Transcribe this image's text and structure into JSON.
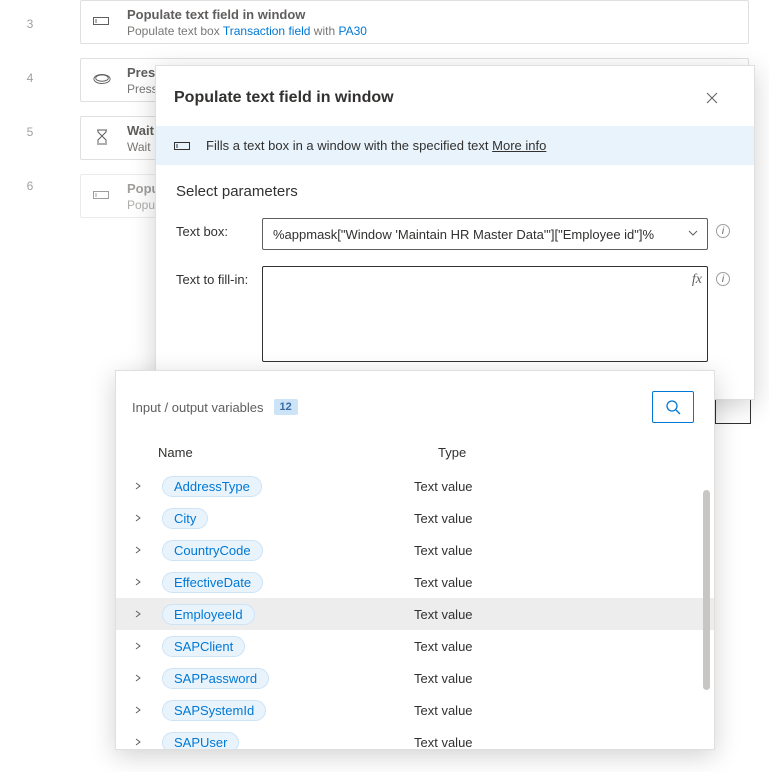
{
  "lines": [
    "3",
    "4",
    "5",
    "6"
  ],
  "actions": [
    {
      "title": "Populate text field in window",
      "sub_pre": "Populate text box ",
      "sub_hl1": "Transaction field",
      "sub_mid": " with ",
      "sub_hl2": "PA30",
      "icon": "textfield"
    },
    {
      "title": "Press",
      "sub_pre": "Press",
      "icon": "press"
    },
    {
      "title": "Wait",
      "sub_pre": "Wait",
      "icon": "wait"
    },
    {
      "title": "Popu",
      "sub_pre": "Popu",
      "icon": "textfield",
      "dimmed": true
    }
  ],
  "dialog": {
    "title": "Populate text field in window",
    "info_text": "Fills a text box in a window with the specified text ",
    "info_link": "More info",
    "section": "Select parameters",
    "textbox_label": "Text box:",
    "textbox_value": "%appmask[\"Window 'Maintain HR Master Data'\"][\"Employee id\"]%",
    "fill_label": "Text to fill-in:",
    "fill_value": ""
  },
  "vars": {
    "title": "Input / output variables",
    "count": "12",
    "col_name": "Name",
    "col_type": "Type",
    "items": [
      {
        "name": "AddressType",
        "type": "Text value"
      },
      {
        "name": "City",
        "type": "Text value"
      },
      {
        "name": "CountryCode",
        "type": "Text value"
      },
      {
        "name": "EffectiveDate",
        "type": "Text value"
      },
      {
        "name": "EmployeeId",
        "type": "Text value",
        "hover": true
      },
      {
        "name": "SAPClient",
        "type": "Text value"
      },
      {
        "name": "SAPPassword",
        "type": "Text value"
      },
      {
        "name": "SAPSystemId",
        "type": "Text value"
      },
      {
        "name": "SAPUser",
        "type": "Text value"
      }
    ]
  }
}
